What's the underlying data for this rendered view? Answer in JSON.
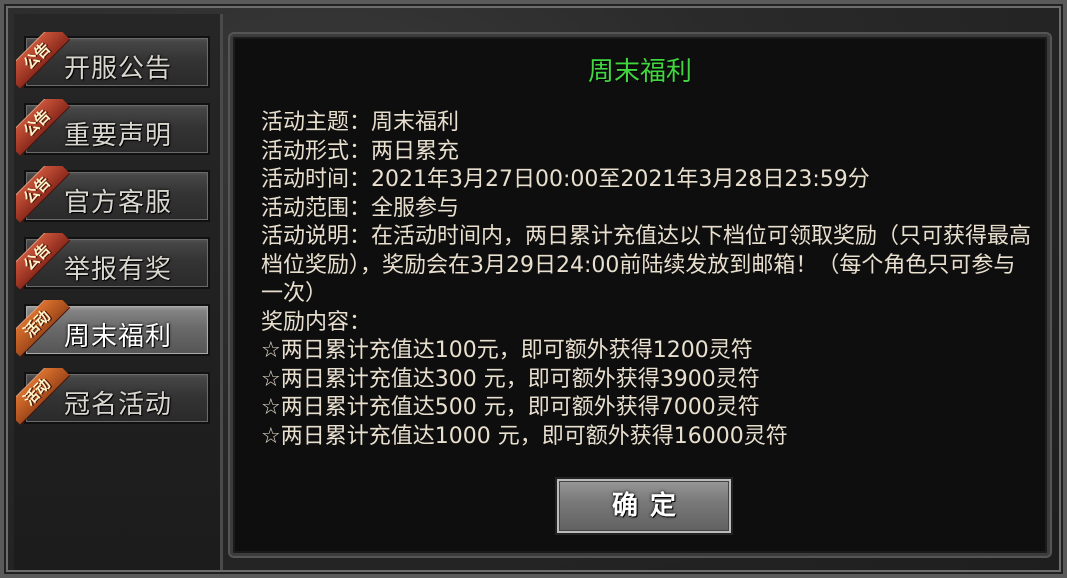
{
  "sidebar": {
    "tabs": [
      {
        "badge": "公告",
        "label": "开服公告",
        "active": false
      },
      {
        "badge": "公告",
        "label": "重要声明",
        "active": false
      },
      {
        "badge": "公告",
        "label": "官方客服",
        "active": false
      },
      {
        "badge": "公告",
        "label": "举报有奖",
        "active": false
      },
      {
        "badge": "活动",
        "label": "周末福利",
        "active": true
      },
      {
        "badge": "活动",
        "label": "冠名活动",
        "active": false
      }
    ]
  },
  "panel": {
    "title": "周末福利",
    "lines": [
      "活动主题：周末福利",
      "活动形式：两日累充",
      "活动时间：2021年3月27日00:00至2021年3月28日23:59分",
      "活动范围：全服参与"
    ],
    "description": "活动说明：在活动时间内，两日累计充值达以下档位可领取奖励（只可获得最高档位奖励），奖励会在3月29日24:00前陆续发放到邮箱！（每个角色只可参与一次）",
    "reward_heading": "奖励内容：",
    "rewards": [
      "☆两日累计充值达100元，即可额外获得1200灵符",
      "☆两日累计充值达300 元，即可额外获得3900灵符",
      "☆两日累计充值达500 元，即可额外获得7000灵符",
      "☆两日累计充值达1000 元，即可额外获得16000灵符"
    ],
    "confirm_label": "确定"
  }
}
